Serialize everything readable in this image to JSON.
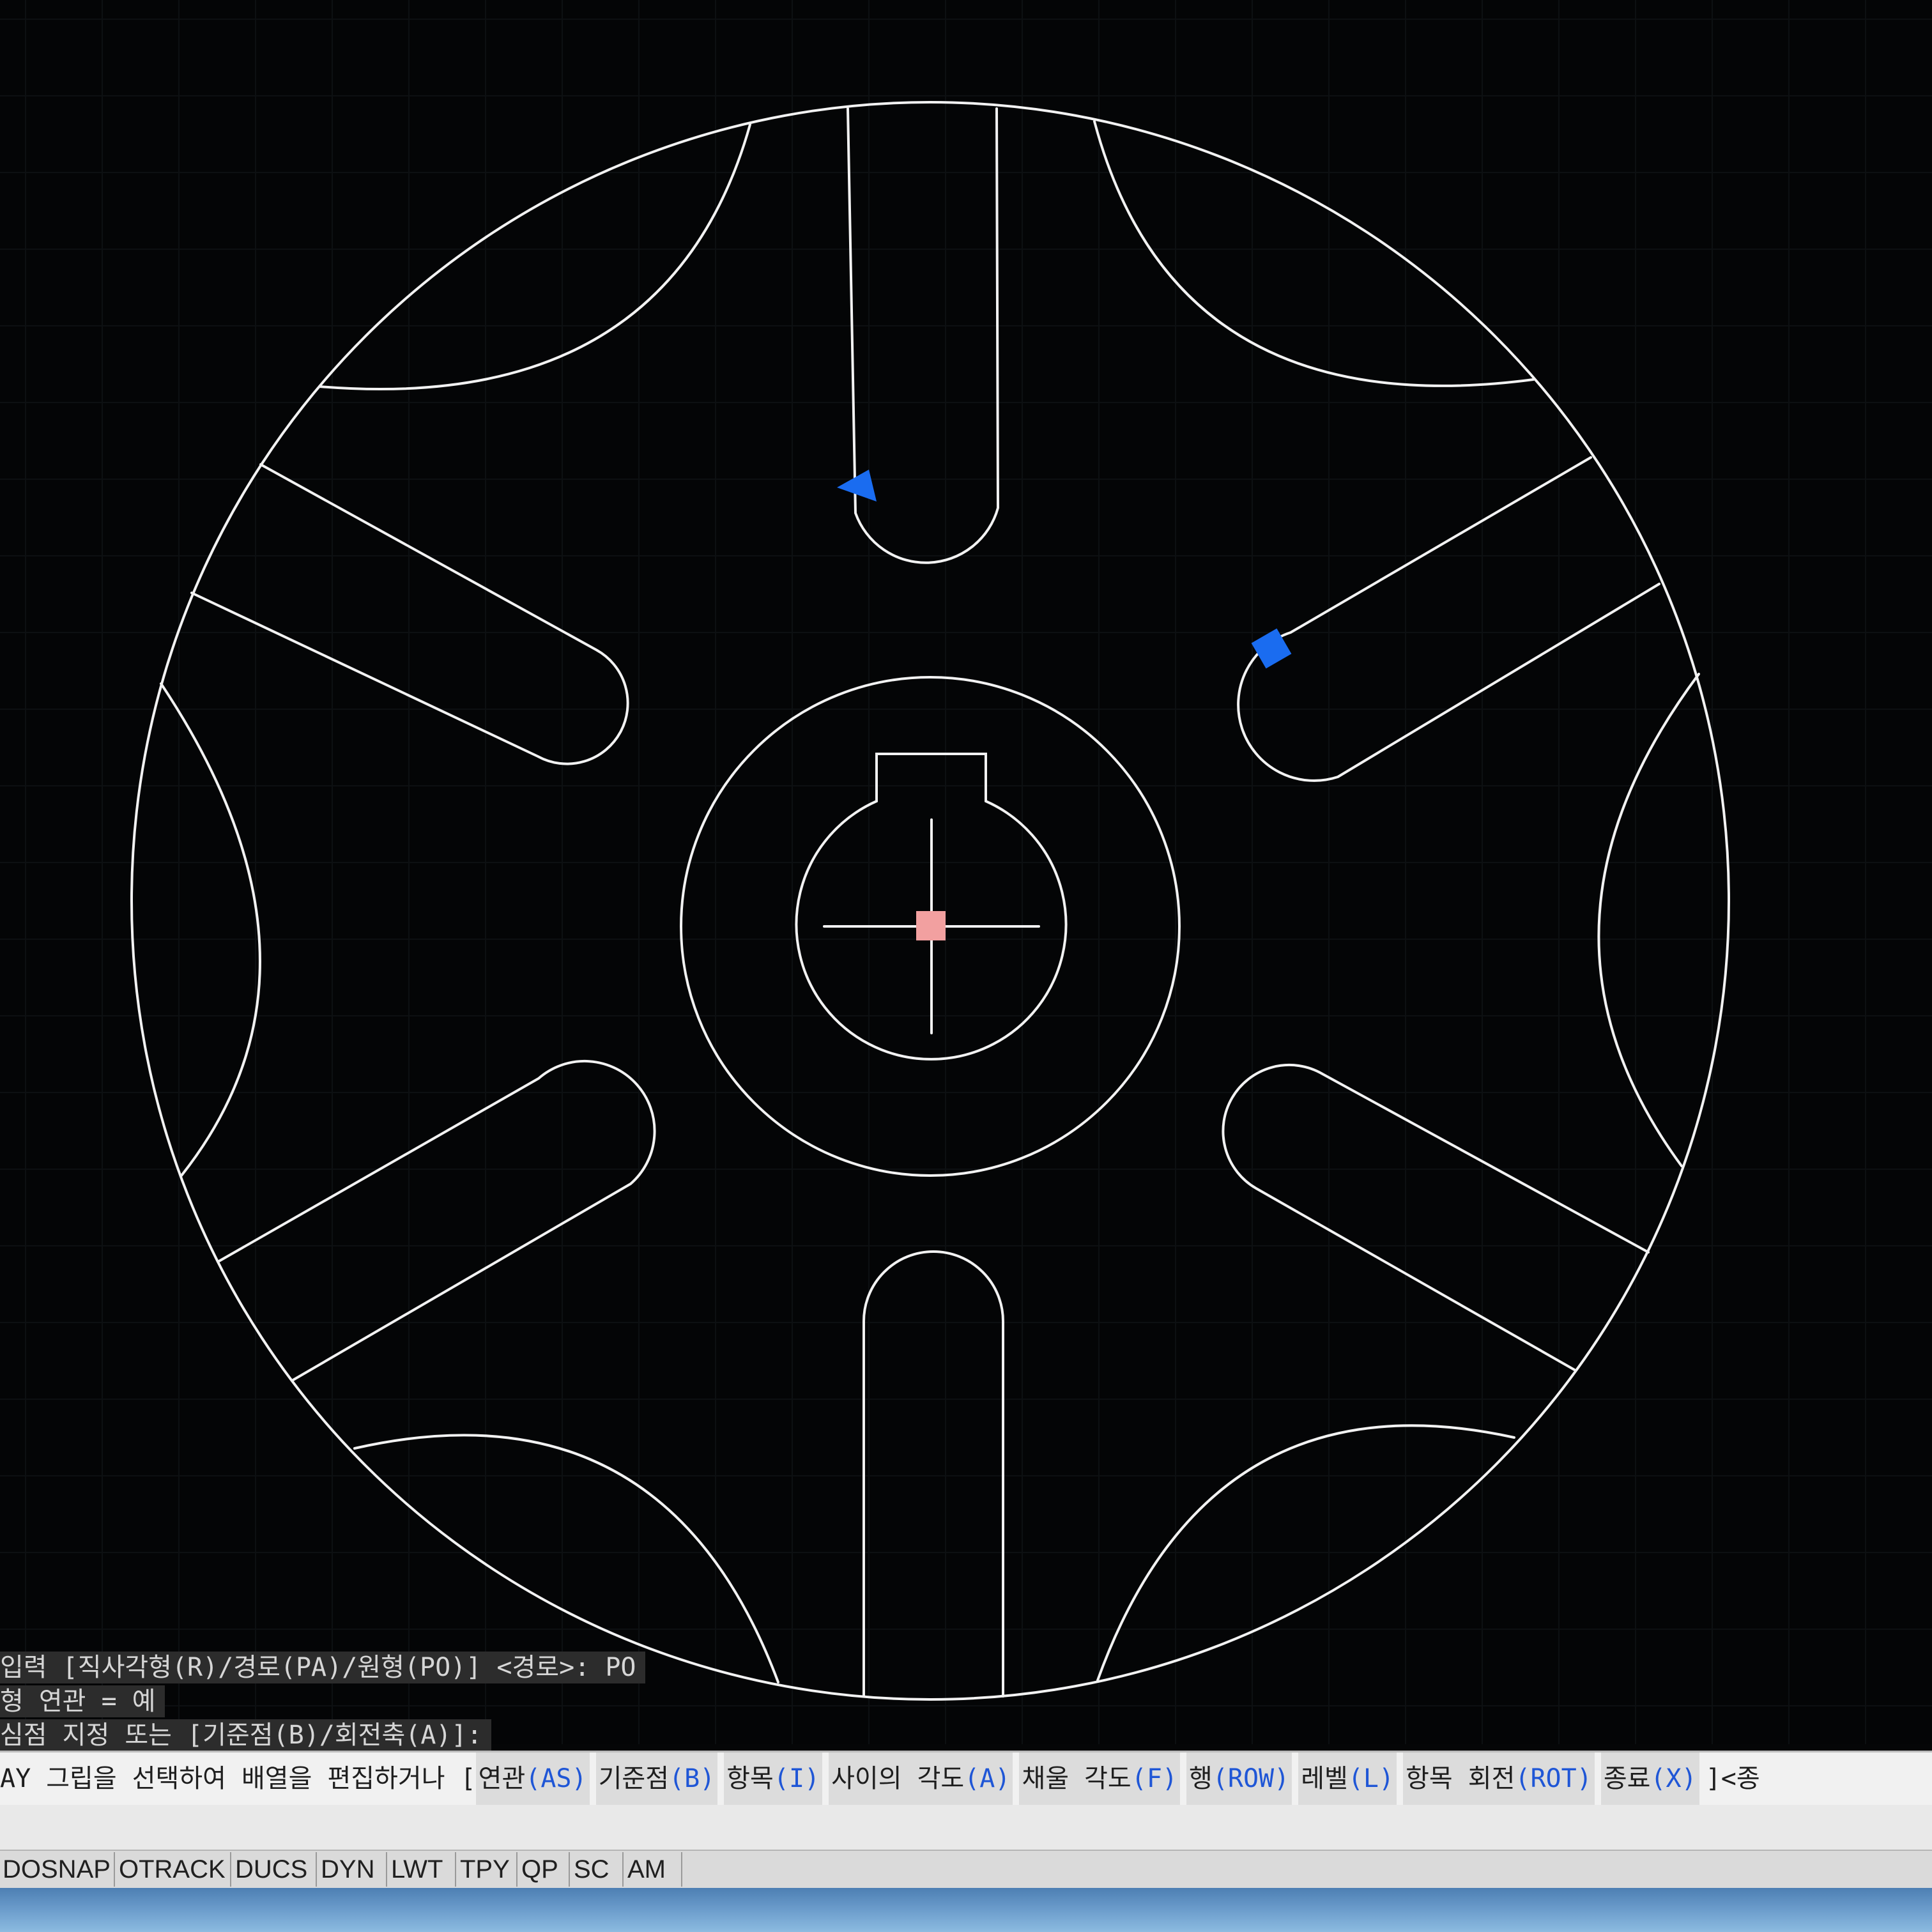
{
  "command_history": [
    "입력 [직사각형(R)/경로(PA)/원형(PO)] <경로>: PO",
    "형  연관 = 예",
    "심점 지정 또는 [기준점(B)/회전축(A)]:"
  ],
  "command_line": {
    "prefix": "AY 그립을 선택하여 배열을 편집하거나 [",
    "options": [
      {
        "label": "연관",
        "key": "(AS)"
      },
      {
        "label": "기준점",
        "key": "(B)"
      },
      {
        "label": "항목",
        "key": "(I)"
      },
      {
        "label": "사이의 각도",
        "key": "(A)"
      },
      {
        "label": "채울 각도",
        "key": "(F)"
      },
      {
        "label": "행",
        "key": "(ROW)"
      },
      {
        "label": "레벨",
        "key": "(L)"
      },
      {
        "label": "항목 회전",
        "key": "(ROT)"
      },
      {
        "label": "종료",
        "key": "(X)"
      }
    ],
    "suffix": "]<종"
  },
  "status_bar": {
    "toggles": [
      "DOSNAP",
      "OTRACK",
      "DUCS",
      "DYN",
      "LWT",
      "TPY",
      "QP",
      "SC",
      "AM"
    ]
  },
  "colors": {
    "background": "#040506",
    "geometry": "#f2f2f2",
    "grip": "#1a6cf0",
    "base_grip": "#f08a8a"
  }
}
